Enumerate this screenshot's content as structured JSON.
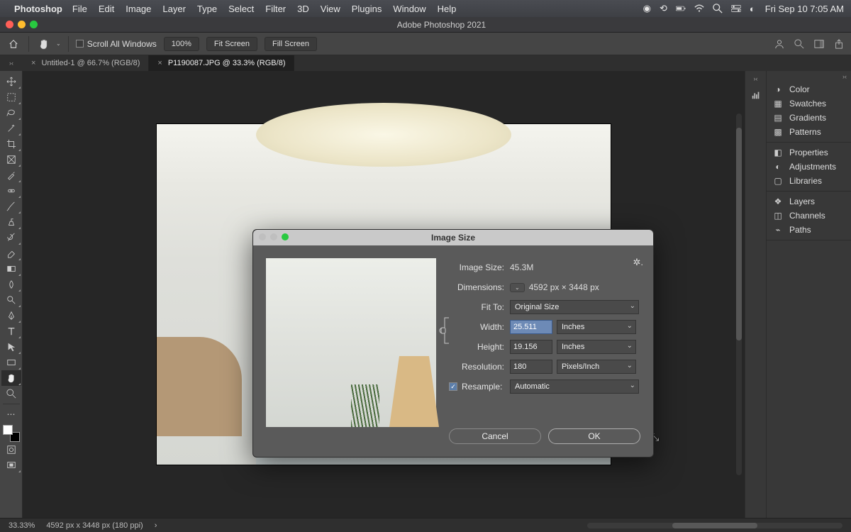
{
  "mac": {
    "app": "Photoshop",
    "menus": [
      "File",
      "Edit",
      "Image",
      "Layer",
      "Type",
      "Select",
      "Filter",
      "3D",
      "View",
      "Plugins",
      "Window",
      "Help"
    ],
    "clock": "Fri Sep 10  7:05 AM"
  },
  "window": {
    "title": "Adobe Photoshop 2021"
  },
  "options": {
    "scroll_all_label": "Scroll All Windows",
    "zoom_value": "100%",
    "fit_screen": "Fit Screen",
    "fill_screen": "Fill Screen"
  },
  "tabs": [
    {
      "label": "Untitled-1 @ 66.7% (RGB/8)",
      "active": false
    },
    {
      "label": "P1190087.JPG @ 33.3% (RGB/8)",
      "active": true
    }
  ],
  "panels": {
    "group1": [
      "Color",
      "Swatches",
      "Gradients",
      "Patterns"
    ],
    "group2": [
      "Properties",
      "Adjustments",
      "Libraries"
    ],
    "group3": [
      "Layers",
      "Channels",
      "Paths"
    ]
  },
  "dialog": {
    "title": "Image Size",
    "image_size_label": "Image Size:",
    "image_size_value": "45.3M",
    "dimensions_label": "Dimensions:",
    "dimensions_value": "4592 px  ×  3448 px",
    "fit_to_label": "Fit To:",
    "fit_to_value": "Original Size",
    "width_label": "Width:",
    "width_value": "25.511",
    "height_label": "Height:",
    "height_value": "19.156",
    "wh_unit": "Inches",
    "resolution_label": "Resolution:",
    "resolution_value": "180",
    "resolution_unit": "Pixels/Inch",
    "resample_label": "Resample:",
    "resample_value": "Automatic",
    "cancel": "Cancel",
    "ok": "OK"
  },
  "status": {
    "zoom": "33.33%",
    "info": "4592 px x 3448 px (180 ppi)"
  }
}
